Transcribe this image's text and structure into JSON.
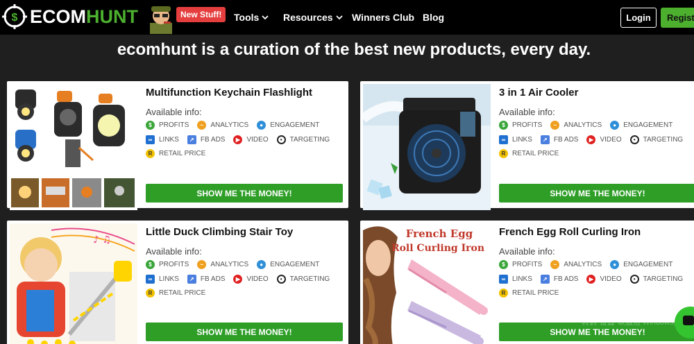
{
  "nav": {
    "logo_text_white": "ECOM",
    "logo_text_green": "HUNT",
    "badge": "New Stuff!",
    "links": [
      "Tools",
      "Resources",
      "Winners Club",
      "Blog"
    ],
    "login": "Login",
    "register": "Register"
  },
  "headline": "ecomhunt is a curation of the best new products, every day.",
  "common": {
    "available": "Available info:",
    "tags": [
      "PROFITS",
      "ANALYTICS",
      "ENGAGEMENT",
      "LINKS",
      "FB ADS",
      "VIDEO",
      "TARGETING",
      "RETAIL PRICE"
    ],
    "button": "SHOW ME THE MONEY!"
  },
  "products": [
    {
      "title": "Multifunction Keychain Flashlight"
    },
    {
      "title": "3 in 1 Air Cooler"
    },
    {
      "title": "Little Duck Climbing Stair Toy"
    },
    {
      "title": "French Egg Roll Curling Iron",
      "image_text_1": "French Egg",
      "image_text_2": "Roll Curling Iron"
    }
  ],
  "colors": {
    "brand_green": "#4caf2e",
    "button_green": "#2e9e27",
    "badge_red": "#e53e3e"
  },
  "watermark": {
    "line1": "激活 Windows",
    "line2": "转到\"设置\"以激活 Windows。"
  }
}
